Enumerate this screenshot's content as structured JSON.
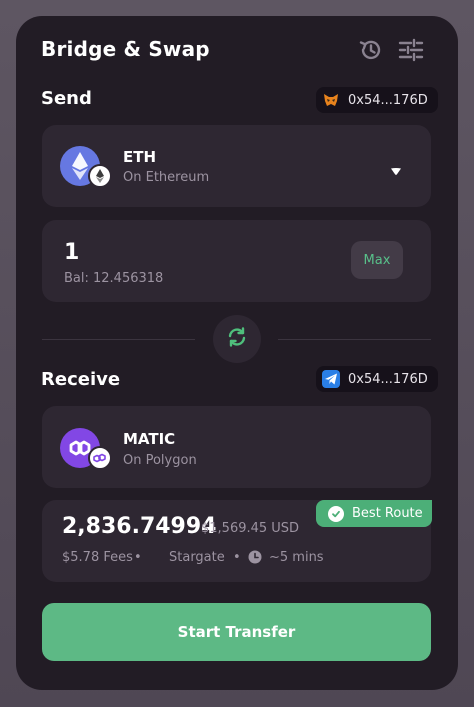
{
  "header": {
    "title": "Bridge & Swap"
  },
  "send": {
    "label": "Send",
    "wallet": "0x54...176D",
    "token": {
      "symbol": "ETH",
      "network": "On Ethereum"
    },
    "amount": "1",
    "balance": "Bal: 12.456318",
    "max_label": "Max"
  },
  "receive": {
    "label": "Receive",
    "wallet": "0x54...176D",
    "token": {
      "symbol": "MATIC",
      "network": "On Polygon"
    },
    "amount": "2,836.74994",
    "usd_value": "$1,569.45 USD",
    "fees": "$5.78 Fees",
    "separator_1": "•",
    "route": "Stargate",
    "separator_2": "•",
    "time": "~5 mins",
    "badge": "Best Route"
  },
  "cta_label": "Start Transfer",
  "colors": {
    "accent": "#5db985",
    "badge": "#4caf78",
    "panel": "#221c25",
    "card": "#2e2732"
  }
}
